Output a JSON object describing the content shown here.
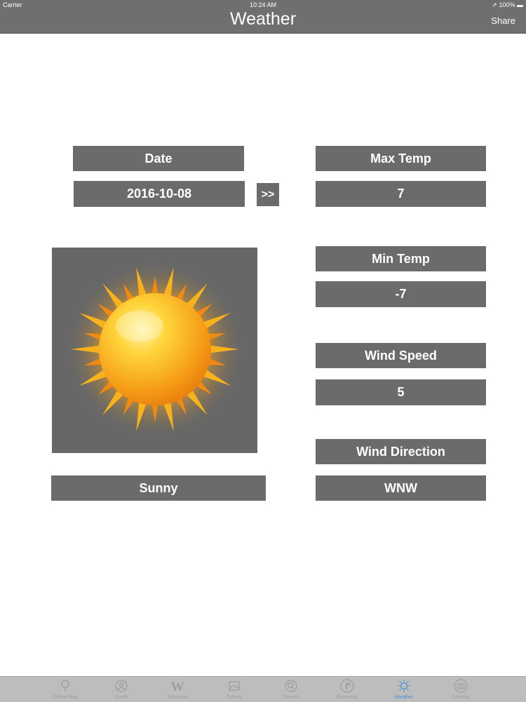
{
  "status_bar": {
    "carrier": "Carrier",
    "time": "10:24 AM",
    "battery": "100%"
  },
  "nav": {
    "title": "Weather",
    "share_label": "Share"
  },
  "date": {
    "label": "Date",
    "value": "2016-10-08",
    "next_button": ">>"
  },
  "max_temp": {
    "label": "Max Temp",
    "value": "7"
  },
  "min_temp": {
    "label": "Min Temp",
    "value": "-7"
  },
  "wind_speed": {
    "label": "Wind Speed",
    "value": "5"
  },
  "wind_direction": {
    "label": "Wind Direction",
    "value": "WNW"
  },
  "condition": {
    "icon": "sun-icon",
    "label": "Sunny"
  },
  "tab_bar": {
    "tabs": [
      {
        "label": "Offline Map",
        "icon": "map-pin-icon"
      },
      {
        "label": "Guide",
        "icon": "guide-icon"
      },
      {
        "label": "Wikipedia",
        "icon": "wikipedia-icon"
      },
      {
        "label": "Gallery",
        "icon": "gallery-icon"
      },
      {
        "label": "Search",
        "icon": "search-icon"
      },
      {
        "label": "Directions",
        "icon": "directions-icon"
      },
      {
        "label": "Weather",
        "icon": "weather-sun-icon"
      },
      {
        "label": "Camera",
        "icon": "camera-icon"
      }
    ],
    "active_color": "#4a8fd8"
  }
}
